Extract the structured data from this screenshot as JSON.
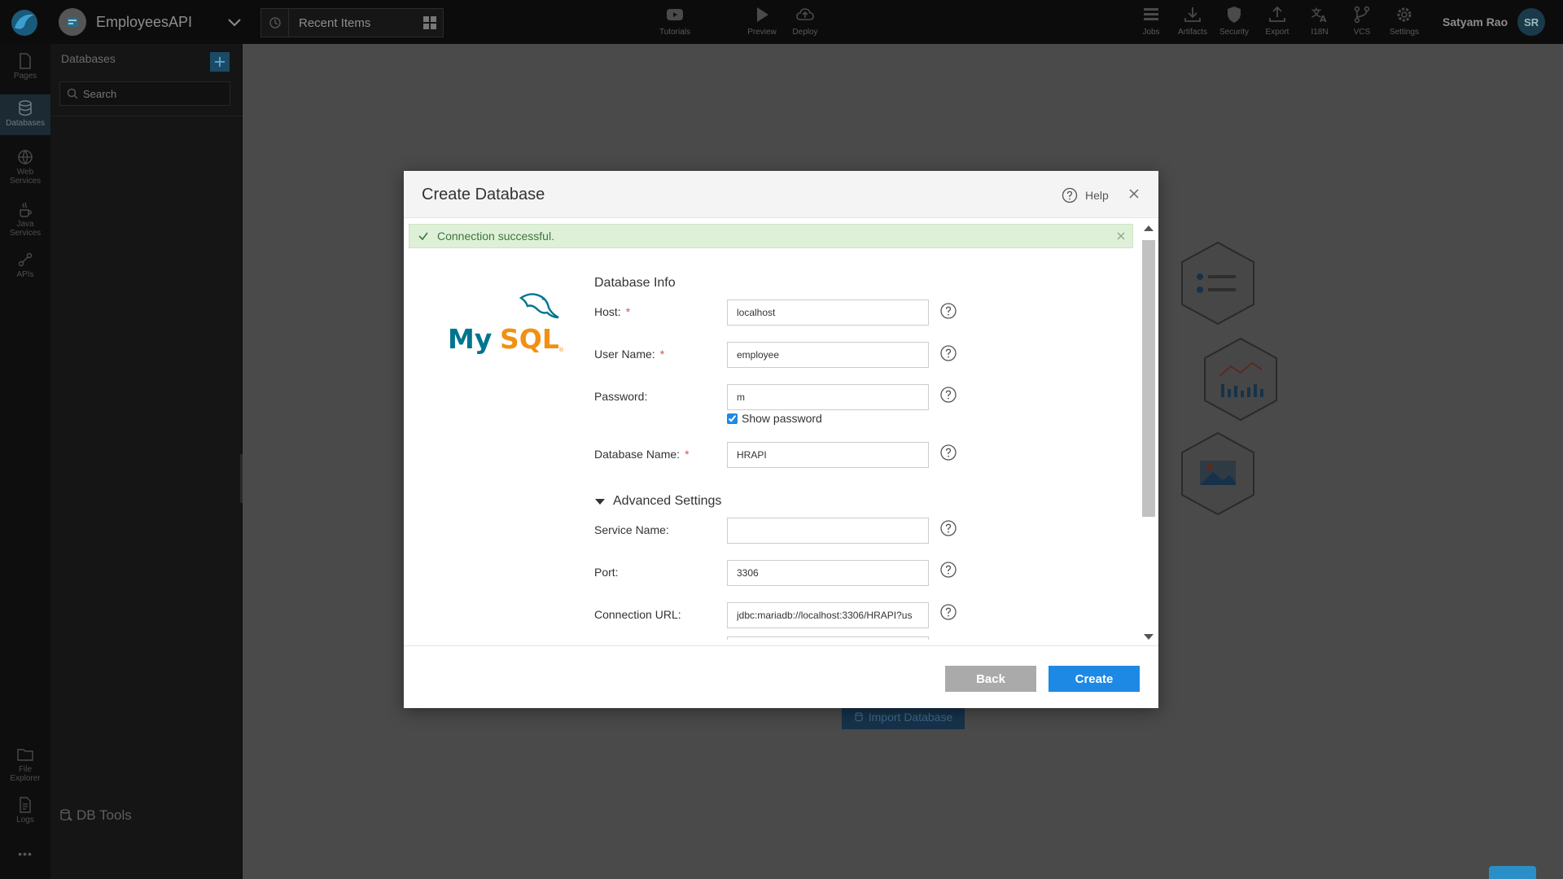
{
  "topbar": {
    "project_name": "EmployeesAPI",
    "recent_label": "Recent Items",
    "tools": [
      {
        "label": "Tutorials",
        "icon": "youtube-icon"
      },
      {
        "label": "Preview",
        "icon": "play-icon"
      },
      {
        "label": "Deploy",
        "icon": "cloud-upload-icon"
      }
    ],
    "right_tools": [
      {
        "label": "Jobs",
        "icon": "jobs-icon"
      },
      {
        "label": "Artifacts",
        "icon": "download-icon"
      },
      {
        "label": "Security",
        "icon": "shield-icon"
      },
      {
        "label": "Export",
        "icon": "export-icon"
      },
      {
        "label": "I18N",
        "icon": "translate-icon"
      },
      {
        "label": "VCS",
        "icon": "branch-icon"
      },
      {
        "label": "Settings",
        "icon": "gear-icon"
      }
    ],
    "user_name": "Satyam Rao",
    "user_initials": "SR"
  },
  "rail": {
    "items": [
      {
        "label": "Pages",
        "icon": "page-icon"
      },
      {
        "label": "Databases",
        "icon": "database-icon"
      },
      {
        "label": "Web Services",
        "icon": "globe-icon"
      },
      {
        "label": "Java Services",
        "icon": "java-icon"
      },
      {
        "label": "APIs",
        "icon": "api-icon"
      }
    ],
    "bottom_items": [
      {
        "label": "File Explorer",
        "icon": "folder-icon"
      },
      {
        "label": "Logs",
        "icon": "log-icon"
      }
    ],
    "more_label": "•••"
  },
  "dbpanel": {
    "title": "Databases",
    "search_placeholder": "Search",
    "db_tools_label": "DB Tools"
  },
  "background": {
    "import_label": "Import Database"
  },
  "modal": {
    "title": "Create Database",
    "help_label": "Help",
    "alert_text": "Connection successful.",
    "section_title": "Database Info",
    "fields": {
      "host": {
        "label": "Host:",
        "value": "localhost"
      },
      "username": {
        "label": "User Name:",
        "value": "employee"
      },
      "password": {
        "label": "Password:",
        "value": "m"
      },
      "show_password": "Show password",
      "dbname": {
        "label": "Database Name:",
        "value": "HRAPI"
      },
      "advanced": "Advanced Settings",
      "service": {
        "label": "Service Name:",
        "value": ""
      },
      "port": {
        "label": "Port:",
        "value": "3306"
      },
      "url": {
        "label": "Connection URL:",
        "value": "jdbc:mariadb://localhost:3306/HRAPI?us"
      }
    },
    "required_mark": "*",
    "back_label": "Back",
    "create_label": "Create"
  },
  "colors": {
    "primary": "#1e88e5",
    "success_bg": "#dff0d8",
    "success_text": "#3c763d",
    "required": "#d9534f",
    "mysql_blue": "#00758f",
    "mysql_orange": "#f29111"
  }
}
